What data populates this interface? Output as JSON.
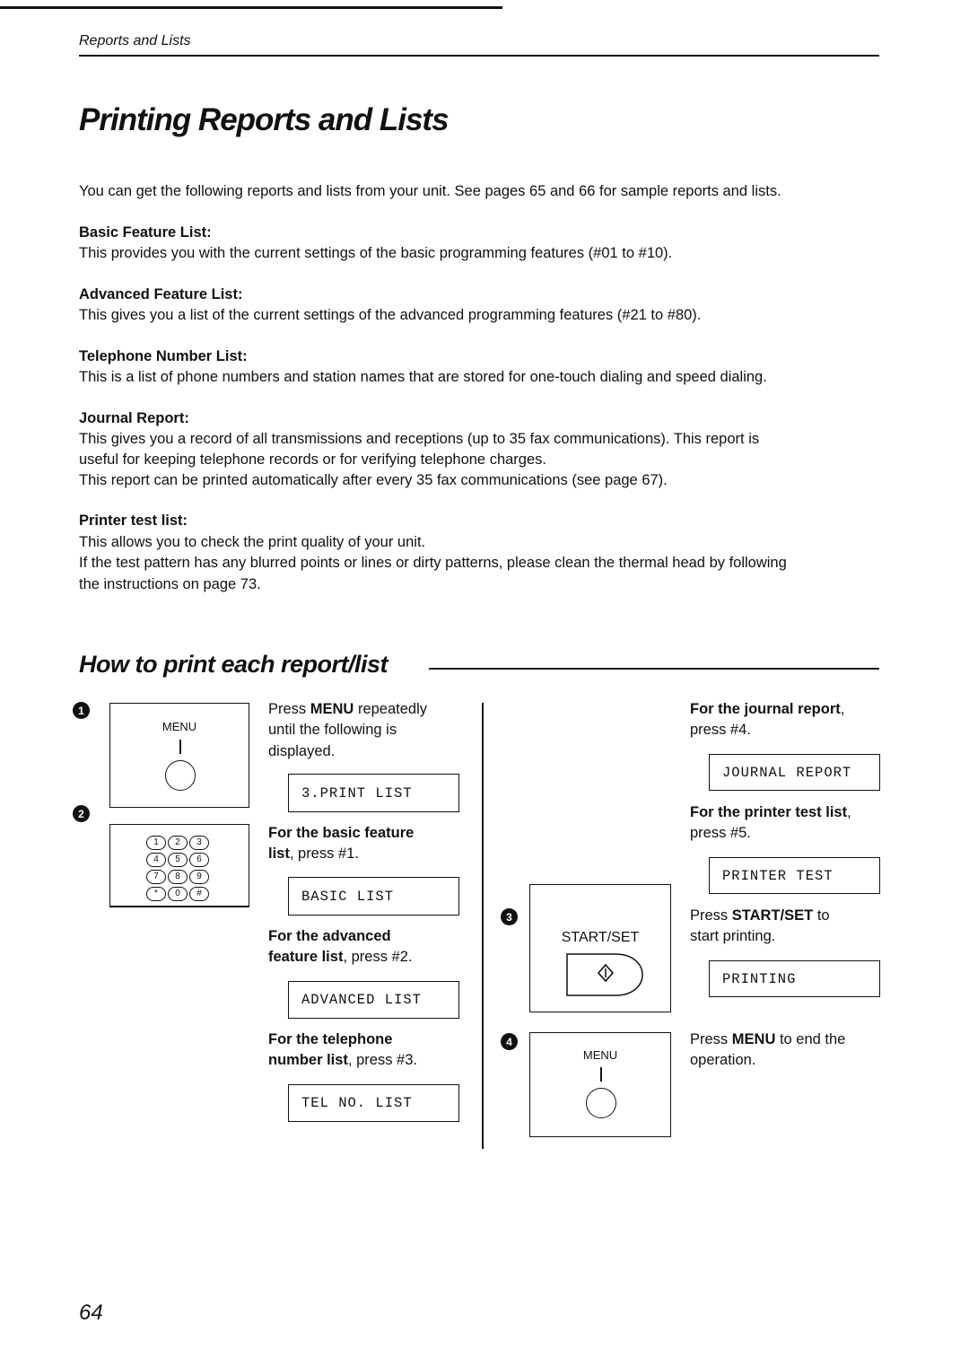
{
  "header": {
    "section": "Reports and Lists"
  },
  "title": "Printing Reports and Lists",
  "intro": "You can get the following reports and lists from your unit. See pages 65 and 66 for sample reports and lists.",
  "items": [
    {
      "heading": "Basic Feature List:",
      "lines": [
        "This provides you with the current settings of the basic programming features (#01 to #10)."
      ]
    },
    {
      "heading": "Advanced Feature List:",
      "lines": [
        "This gives you a list of the current settings of the advanced programming features (#21 to #80)."
      ]
    },
    {
      "heading": "Telephone Number List:",
      "lines": [
        "This is a list of phone numbers and station names that are stored for one-touch dialing and speed dialing."
      ]
    },
    {
      "heading": "Journal Report:",
      "lines": [
        "This gives you a record of all transmissions and receptions (up to 35 fax communications). This report is",
        "useful for keeping telephone records or for verifying telephone charges.",
        "This report can be printed automatically after every 35 fax communications (see page 67)."
      ]
    },
    {
      "heading": "Printer test list:",
      "lines": [
        "This allows you to check the print quality of your unit.",
        "If the test pattern has any blurred points or lines or dirty patterns, please clean the thermal head by following",
        "the instructions on page 73."
      ]
    }
  ],
  "how_to": {
    "heading": "How to print each report/list",
    "steps": [
      {
        "number": "1",
        "button": "MENU",
        "lines": [
          "Press MENU repeatedly",
          "until the following is",
          "displayed."
        ],
        "bold": "MENU",
        "display": "3.PRINT LIST"
      },
      {
        "number": "2",
        "keypad": [
          "1",
          "2",
          "3",
          "4",
          "5",
          "6",
          "7",
          "8",
          "9",
          "*",
          "0",
          "#"
        ]
      },
      {
        "number": "3",
        "button": "START/SET",
        "bold": "START/SET",
        "text_rest": " to",
        "line2": "start printing.",
        "display": "PRINTING"
      },
      {
        "number": "4",
        "button": "MENU",
        "bold": "MENU",
        "text_rest": " to end the",
        "line2": "operation."
      }
    ],
    "options": [
      {
        "bold": "For the basic feature",
        "bold2": "list",
        "rest": ", press #1.",
        "display": "BASIC LIST"
      },
      {
        "bold": "For the advanced",
        "bold2": "feature list",
        "rest": ", press #2.",
        "display": "ADVANCED LIST"
      },
      {
        "bold": "For the telephone",
        "bold2": "number list",
        "rest": ", press #3.",
        "display": "TEL NO. LIST"
      },
      {
        "bold": "For the journal report",
        "rest": ",",
        "line2": "press #4.",
        "display": "JOURNAL REPORT"
      },
      {
        "bold": "For the printer test list",
        "rest": ",",
        "line2": "press #5.",
        "display": "PRINTER TEST"
      }
    ],
    "press_word": "Press"
  },
  "page_number": "64"
}
